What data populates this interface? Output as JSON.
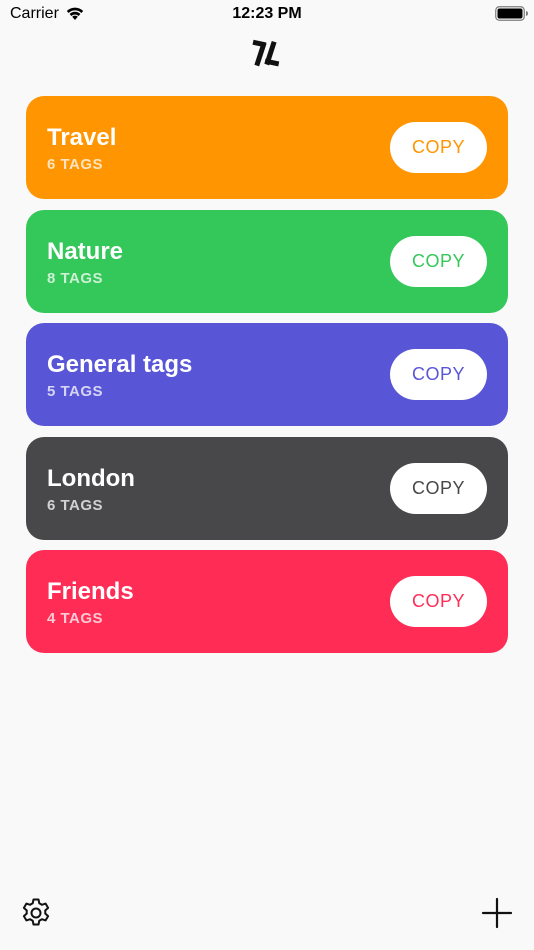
{
  "status_bar": {
    "carrier": "Carrier",
    "time": "12:23 PM"
  },
  "header": {
    "logo_icon": "tl-logo-icon"
  },
  "tag_groups": [
    {
      "name": "Travel",
      "count": "6 TAGS",
      "copy_label": "COPY",
      "color": "#ff9500"
    },
    {
      "name": "Nature",
      "count": "8 TAGS",
      "copy_label": "COPY",
      "color": "#34c759"
    },
    {
      "name": "General tags",
      "count": "5 TAGS",
      "copy_label": "COPY",
      "color": "#5856d6"
    },
    {
      "name": "London",
      "count": "6 TAGS",
      "copy_label": "COPY",
      "color": "#48484a"
    },
    {
      "name": "Friends",
      "count": "4 TAGS",
      "copy_label": "COPY",
      "color": "#ff2d55"
    }
  ],
  "toolbar": {
    "settings_icon": "gear-icon",
    "add_icon": "plus-icon"
  }
}
